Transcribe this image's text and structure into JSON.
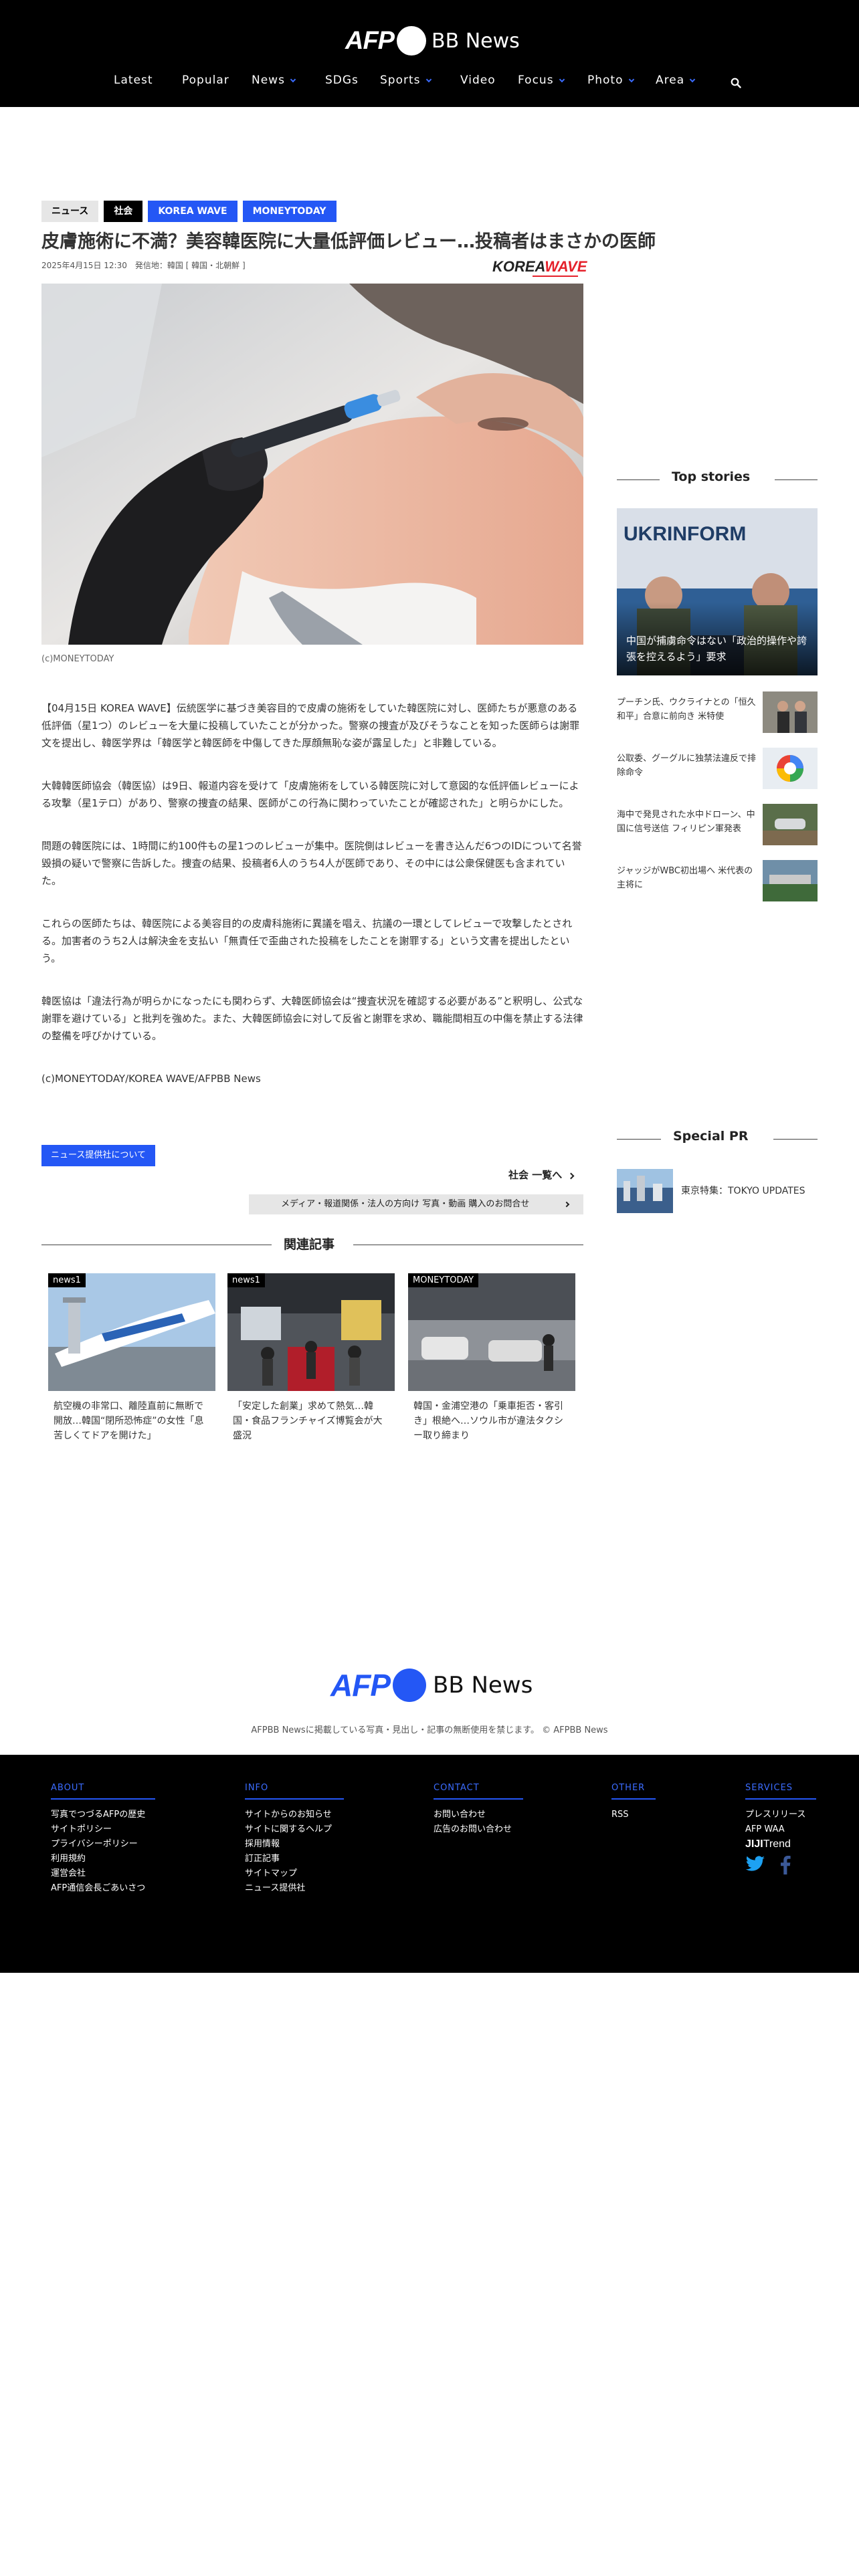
{
  "header": {
    "logo_afp": "AFP",
    "logo_bb": "BB News",
    "nav": [
      {
        "label": "Latest",
        "has_dropdown": false
      },
      {
        "label": "Popular",
        "has_dropdown": false
      },
      {
        "label": "News",
        "has_dropdown": true
      },
      {
        "label": "SDGs",
        "has_dropdown": false
      },
      {
        "label": "Sports",
        "has_dropdown": true
      },
      {
        "label": "Video",
        "has_dropdown": false
      },
      {
        "label": "Focus",
        "has_dropdown": true
      },
      {
        "label": "Photo",
        "has_dropdown": true
      },
      {
        "label": "Area",
        "has_dropdown": true
      }
    ],
    "search_icon": "search-icon"
  },
  "article": {
    "tags": [
      "ニュース",
      "社会",
      "KOREA WAVE",
      "MONEYTODAY"
    ],
    "title": "皮膚施術に不満？美容韓医院に大量低評価レビュー…投稿者はまさかの医師",
    "meta": "2025年4月15日 12:30　発信地：韓国 [ 韓国・北朝鮮 ]",
    "source_logo": {
      "left": "KOREA",
      "right": "WAVE"
    },
    "caption": "(c)MONEYTODAY",
    "paragraphs": [
      "【04月15日 KOREA WAVE】伝統医学に基づき美容目的で皮膚の施術をしていた韓医院に対し、医師たちが悪意のある低評価（星1つ）のレビューを大量に投稿していたことが分かった。警察の捜査が及びそうなことを知った医師らは謝罪文を提出し、韓医学界は「韓医学と韓医師を中傷してきた厚顔無恥な姿が露呈した」と非難している。",
      "大韓韓医師協会（韓医協）は9日、報道内容を受けて「皮膚施術をしている韓医院に対して意図的な低評価レビューによる攻撃（星1テロ）があり、警察の捜査の結果、医師がこの行為に関わっていたことが確認された」と明らかにした。",
      "問題の韓医院には、1時間に約100件もの星1つのレビューが集中。医院側はレビューを書き込んだ6つのIDについて名誉毀損の疑いで警察に告訴した。捜査の結果、投稿者6人のうち4人が医師であり、その中には公衆保健医も含まれていた。",
      "これらの医師たちは、韓医院による美容目的の皮膚科施術に異議を唱え、抗議の一環としてレビューで攻撃したとされる。加害者のうち2人は解決金を支払い「無責任で歪曲された投稿をしたことを謝罪する」という文書を提出したという。",
      "韓医協は「違法行為が明らかになったにも関わらず、大韓医師協会は“捜査状況を確認する必要がある”と釈明し、公式な謝罪を避けている」と批判を強めた。また、大韓医師協会に対して反省と謝罪を求め、職能間相互の中傷を禁止する法律の整備を呼びかけている。"
    ],
    "credit": "(c)MONEYTODAY/KOREA WAVE/AFPBB News",
    "provider_button": "ニュース提供社について",
    "more_link": "社会 一覧へ",
    "media_bar": "メディア・報道関係・法人の方向け 写真・動画 購入のお問合せ"
  },
  "related": {
    "heading": "関連記事",
    "items": [
      {
        "badge": "news1",
        "title": "航空機の非常口、離陸直前に無断で開放…韓国“閉所恐怖症”の女性「息苦しくてドアを開けた」"
      },
      {
        "badge": "news1",
        "title": "「安定した創業」求めて熱気…韓国・食品フランチャイズ博覧会が大盛況"
      },
      {
        "badge": "MONEYTODAY",
        "title": "韓国・金浦空港の「乗車拒否・客引き」根絶へ…ソウル市が違法タクシー取り締まり"
      }
    ]
  },
  "sidebar": {
    "top_stories_heading": "Top stories",
    "main_story": {
      "caption": "中国が捕虜命令はない「政治的操作や誇張を控えるよう」要求",
      "sign": "UKRINFORM"
    },
    "items": [
      {
        "title": "プーチン氏、ウクライナとの「恒久和平」合意に前向き 米特使"
      },
      {
        "title": "公取委、グーグルに独禁法違反で排除命令"
      },
      {
        "title": "海中で発見された水中ドローン、中国に信号送信 フィリピン軍発表"
      },
      {
        "title": "ジャッジがWBC初出場へ 米代表の主将に"
      }
    ],
    "special_pr_heading": "Special PR",
    "pr_item": "東京特集：TOKYO UPDATES"
  },
  "footer": {
    "logo_afp": "AFP",
    "logo_bb": "BB News",
    "copyright": "AFPBB Newsに掲載している写真・見出し・記事の無断使用を禁じます。 © AFPBB News",
    "columns": [
      {
        "heading": "ABOUT",
        "links": [
          "写真でつづるAFPの歴史",
          "サイトポリシー",
          "プライバシーポリシー",
          "利用規約",
          "運営会社",
          "AFP通信会長ごあいさつ"
        ]
      },
      {
        "heading": "INFO",
        "links": [
          "サイトからのお知らせ",
          "サイトに関するヘルプ",
          "採用情報",
          "訂正記事",
          "サイトマップ",
          "ニュース提供社"
        ]
      },
      {
        "heading": "CONTACT",
        "links": [
          "お問い合わせ",
          "広告のお問い合わせ"
        ]
      },
      {
        "heading": "OTHER",
        "links": [
          "RSS"
        ]
      },
      {
        "heading": "SERVICES",
        "links": [
          "プレスリリース",
          "AFP WAA"
        ]
      }
    ],
    "jiji_a": "JIJI",
    "jiji_b": "Trend",
    "social_icons": [
      "twitter-icon",
      "facebook-icon"
    ]
  },
  "colors": {
    "accent": "#2457f5",
    "header_bg": "#000000",
    "source_logo_red": "#e5212b"
  }
}
